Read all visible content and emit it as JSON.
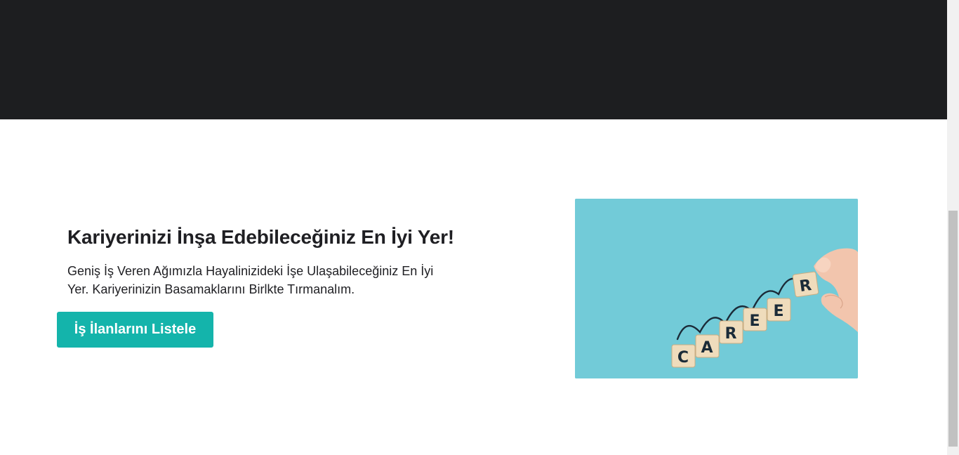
{
  "hero": {
    "title": "Kariyerinizi İnşa Edebileceğiniz En İyi Yer!",
    "description": "Geniş İş Veren Ağımızla Hayalinizideki İşe Ulaşabileceğiniz En İyi Yer. Kariyerinizin Basamaklarını Birlkte Tırmanalım.",
    "cta_label": "İş İlanlarını Listele"
  },
  "image": {
    "letters": [
      "C",
      "A",
      "R",
      "E",
      "E",
      "R"
    ],
    "background_color": "#72cbd8"
  },
  "colors": {
    "header_bg": "#1d1e20",
    "accent": "#14b4ab",
    "text": "#1f1f23"
  }
}
